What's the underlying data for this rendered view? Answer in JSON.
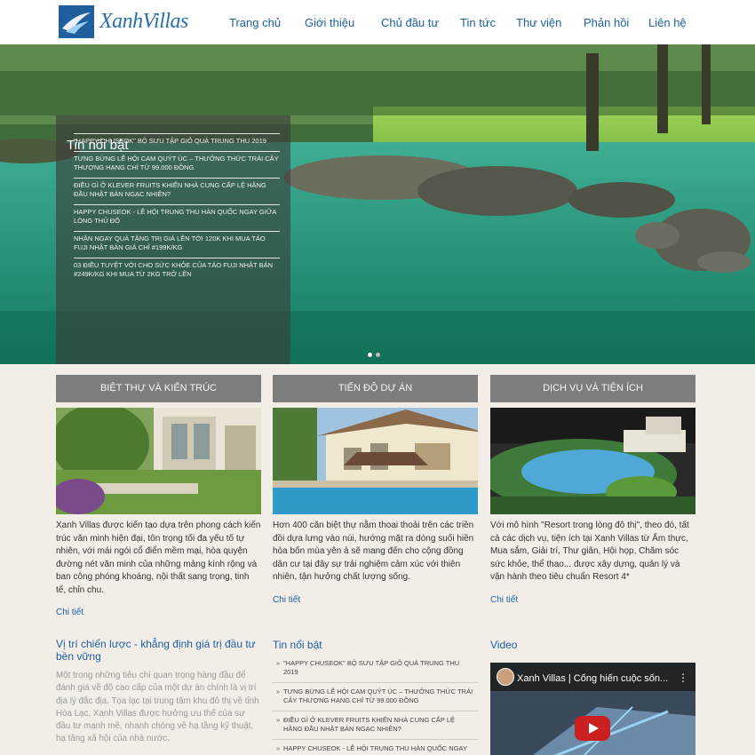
{
  "brand": {
    "name": "XanhVillas"
  },
  "nav": [
    "Trang chủ",
    "Giới thiệu",
    "Chủ đầu tư",
    "Tin tức",
    "Thư viện",
    "Phản hồi",
    "Liên hệ"
  ],
  "featured": {
    "title": "Tin nổi bật",
    "items": [
      "\"HAPPY CHUSEOK\" BỘ SƯU TẬP GIỎ QUÀ TRUNG THU 2019",
      "TƯNG BỪNG LỄ HỘI CAM QUÝT ÚC – THƯỞNG THỨC TRÁI CÂY THƯỢNG HẠNG CHỈ TỪ 99.000 ĐỒNG",
      "ĐIỀU GÌ Ở KLEVER FRUITS KHIẾN NHÀ CUNG CẤP LỆ HẰNG ĐẦU NHẬT BẢN NGẠC NHIÊN?",
      "HAPPY CHUSEOK - LỄ HỘI TRUNG THU HÀN QUỐC NGAY GIỮA LÒNG THỦ ĐÔ",
      "NHẬN NGAY QUÀ TẶNG TRỊ GIÁ LÊN TỚI 120K KHI MUA TÁO FUJI NHẬT BẢN GIÁ CHỈ #199K/KG",
      "03 ĐIỀU TUYỆT VỜI CHO SỨC KHỎE CỦA TÁO FUJI NHẬT BẢN #249K/KG KHI MUA TỪ 2KG TRỞ LÊN"
    ]
  },
  "columns": [
    {
      "heading": "BIỆT THỰ VÀ KIẾN TRÚC",
      "text": "Xanh Villas được kiến tạo dựa trên phong cách kiến trúc văn minh hiện đại, tôn trọng tối đa yếu tố tự nhiên, với mái ngói cổ điển mềm mại, hòa quyện đường nét văn minh của những mảng kính rộng và ban công phóng khoáng, nội thất sang trọng, tinh tế, chỉn chu.",
      "more": "Chi tiết"
    },
    {
      "heading": "TIẾN ĐỘ DỰ ÁN",
      "text": "Hơn 400 căn biệt thự nằm thoai thoải trên các triền đồi dựa lưng vào núi, hướng mặt ra dòng suối hiền hòa bốn mùa yên ả sẽ mang đến cho cộng đồng dân cư tại đây sự trải nghiệm cảm xúc với thiên nhiên, tận hưởng chất lượng sống.",
      "more": "Chi tiết"
    },
    {
      "heading": "DỊCH VỤ VÀ TIỆN ÍCH",
      "text": "Với mô hình \"Resort trong lòng đô thị\", theo đó, tất cả các dịch vụ, tiện ích tại Xanh Villas từ Ẩm thực, Mua sắm, Giải trí, Thư giãn, Hội họp, Chăm sóc sức khỏe, thể thao... được xây dựng, quản lý và vận hành theo tiêu chuẩn Resort 4*",
      "more": "Chi tiết"
    }
  ],
  "strategy": {
    "title": "Vị trí chiến lược - khẳng định giá trị đầu tư bền vững",
    "text": "Một trong những tiêu chí quan trọng hàng đầu để đánh giá về độ cao cấp của một dự án chính là vị trí địa lý đắc địa. Tọa lạc tại trung tâm khu đô thị về tỉnh Hòa Lạc, Xanh Villas được hưởng ưu thế của sự đầu tư mạnh mẽ, nhanh chóng về hạ tầng kỹ thuật, hạ tầng xã hội của nhà nước."
  },
  "news": {
    "title": "Tin nổi bật",
    "items": [
      "\"HAPPY CHUSEOK\" BỘ SƯU TẬP GIỎ QUÀ TRUNG THU 2019",
      "TƯNG BỪNG LỄ HỘI CAM QUÝT ÚC – THƯỞNG THỨC TRÁI CÂY THƯỢNG HẠNG CHỈ TỪ 99.000 ĐỒNG",
      "ĐIỀU GÌ Ở KLEVER FRUITS KHIẾN NHÀ CUNG CẤP LỆ HẰNG ĐẦU NHẬT BẢN NGẠC NHIÊN?",
      "HAPPY CHUSEOK - LỄ HỘI TRUNG THU HÀN QUỐC NGAY"
    ]
  },
  "video": {
    "heading": "Video",
    "title": "Xanh Villas | Cống hiến cuộc sốn..."
  },
  "colors": {
    "accent": "#1d5fa2",
    "heading_bar": "#7d7d7d",
    "background": "#f2eee7"
  }
}
